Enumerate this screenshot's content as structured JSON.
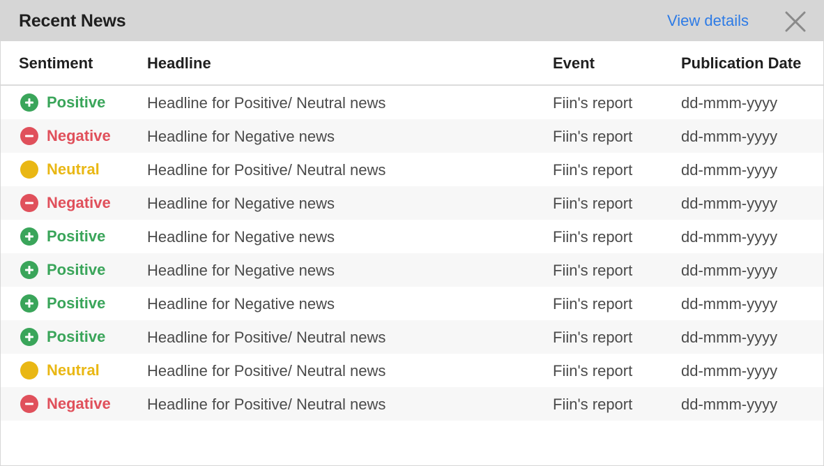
{
  "header": {
    "title": "Recent News",
    "view_details": "View details",
    "close_icon": "close-icon"
  },
  "columns": {
    "sentiment": "Sentiment",
    "headline": "Headline",
    "event": "Event",
    "date": "Publication Date"
  },
  "colors": {
    "positive": "#3aa55a",
    "negative": "#e0505b",
    "neutral": "#e9b714",
    "link": "#2d7be6",
    "header_bg": "#d6d6d6"
  },
  "rows": [
    {
      "sentiment": "Positive",
      "sentiment_type": "positive",
      "icon": "plus-circle-icon",
      "headline": "Headline for Positive/ Neutral news",
      "event": "Fiin's report",
      "date": "dd-mmm-yyyy"
    },
    {
      "sentiment": "Negative",
      "sentiment_type": "negative",
      "icon": "minus-circle-icon",
      "headline": "Headline for Negative news",
      "event": "Fiin's report",
      "date": "dd-mmm-yyyy"
    },
    {
      "sentiment": "Neutral",
      "sentiment_type": "neutral",
      "icon": "dot-circle-icon",
      "headline": "Headline for Positive/ Neutral news",
      "event": "Fiin's report",
      "date": "dd-mmm-yyyy"
    },
    {
      "sentiment": "Negative",
      "sentiment_type": "negative",
      "icon": "minus-circle-icon",
      "headline": "Headline for Negative news",
      "event": "Fiin's report",
      "date": "dd-mmm-yyyy"
    },
    {
      "sentiment": "Positive",
      "sentiment_type": "positive",
      "icon": "plus-circle-icon",
      "headline": "Headline for Negative news",
      "event": "Fiin's report",
      "date": "dd-mmm-yyyy"
    },
    {
      "sentiment": "Positive",
      "sentiment_type": "positive",
      "icon": "plus-circle-icon",
      "headline": "Headline for Negative news",
      "event": "Fiin's report",
      "date": "dd-mmm-yyyy"
    },
    {
      "sentiment": "Positive",
      "sentiment_type": "positive",
      "icon": "plus-circle-icon",
      "headline": "Headline for Negative news",
      "event": "Fiin's report",
      "date": "dd-mmm-yyyy"
    },
    {
      "sentiment": "Positive",
      "sentiment_type": "positive",
      "icon": "plus-circle-icon",
      "headline": "Headline for Positive/ Neutral news",
      "event": "Fiin's report",
      "date": "dd-mmm-yyyy"
    },
    {
      "sentiment": "Neutral",
      "sentiment_type": "neutral",
      "icon": "dot-circle-icon",
      "headline": "Headline for Positive/ Neutral news",
      "event": "Fiin's report",
      "date": "dd-mmm-yyyy"
    },
    {
      "sentiment": "Negative",
      "sentiment_type": "negative",
      "icon": "minus-circle-icon",
      "headline": "Headline for Positive/ Neutral news",
      "event": "Fiin's report",
      "date": "dd-mmm-yyyy"
    }
  ]
}
